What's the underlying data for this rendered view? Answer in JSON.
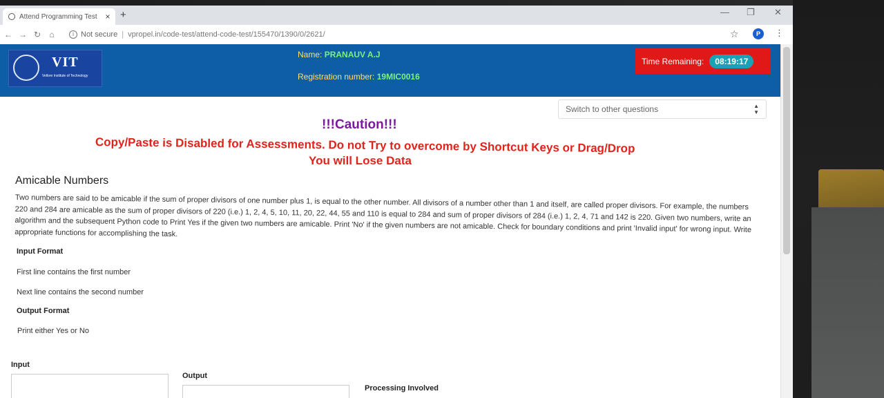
{
  "browser": {
    "tab_title": "Attend Programming Test",
    "new_tab": "+",
    "close": "×",
    "security": "Not secure",
    "url": "vpropel.in/code-test/attend-code-test/155470/1390/0/2621/",
    "profile_initial": "P"
  },
  "header": {
    "logo_text": "VIT",
    "logo_subtitle": "Vellore Institute of Technology",
    "name_label": "Name:",
    "name_value": "PRANAUV A.J",
    "reg_label": "Registration number:",
    "reg_value": "19MIC0016",
    "timer_label": "Time Remaining:",
    "timer_value": "08:19:17"
  },
  "question_select": {
    "placeholder": "Switch to other questions"
  },
  "warning": {
    "caution": "!!!Caution!!!",
    "line1": "Copy/Paste is Disabled for Assessments. Do not Try to overcome by Shortcut Keys or Drag/Drop",
    "line2": "You will Lose Data"
  },
  "question": {
    "title": "Amicable Numbers",
    "description": "Two numbers are said to be amicable if the sum of proper divisors  of one number  plus  1,  is equal to the other number. All divisors  of a number other than 1 and itself,   are called proper divisors. For example, the numbers 220 and 284 are amicable as the sum of proper divisors of 220 (i.e.) 1, 2, 4, 5, 10, 11, 20, 22, 44, 55 and 110 is equal to 284 and sum of proper divisors of 284 (i.e.) 1, 2, 4, 71 and 142 is 220. Given two numbers, write an algorithm and the subsequent Python code to Print Yes if the given two numbers are amicable. Print 'No' if the given numbers are not amicable. Check for boundary conditions and print 'Invalid input' for wrong input. Write appropriate functions for accomplishing the task.",
    "input_format_label": "Input Format",
    "input_line1": "First line contains the first number",
    "input_line2": "Next line contains the second number",
    "output_format_label": "Output Format",
    "output_line1": "Print either Yes or No"
  },
  "io": {
    "input_label": "Input",
    "output_label": "Output",
    "processing_label": "Processing Involved"
  }
}
